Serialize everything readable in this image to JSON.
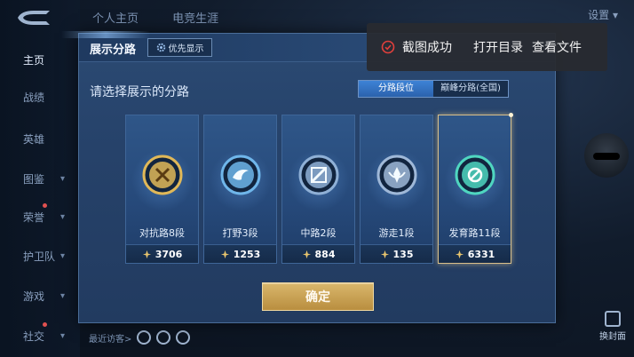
{
  "background": {
    "top_tabs": [
      "个人主页",
      "电竞生涯"
    ],
    "settings_label": "设置",
    "sidebar_items": [
      {
        "label": "主页",
        "active": true,
        "has_chevron": false,
        "badge": false
      },
      {
        "label": "战绩",
        "active": false,
        "has_chevron": false,
        "badge": false
      },
      {
        "label": "英雄",
        "active": false,
        "has_chevron": false,
        "badge": false
      },
      {
        "label": "图鉴",
        "active": false,
        "has_chevron": true,
        "badge": false
      },
      {
        "label": "荣誉",
        "active": false,
        "has_chevron": true,
        "badge": true
      },
      {
        "label": "护卫队",
        "active": false,
        "has_chevron": true,
        "badge": false
      },
      {
        "label": "游戏",
        "active": false,
        "has_chevron": true,
        "badge": false
      },
      {
        "label": "社交",
        "active": false,
        "has_chevron": true,
        "badge": true
      }
    ],
    "recent_visitors_label": "最近访客>",
    "replace_cover_label": "换封面"
  },
  "modal": {
    "title": "展示分路",
    "priority_label": "优先显示",
    "prompt": "请选择展示的分路",
    "toggle": {
      "active": "分路段位",
      "inactive": "巅峰分路(全国)"
    },
    "roles": [
      {
        "name": "对抗路8段",
        "score": "3706",
        "icon": "clash-lane-icon",
        "color": "#e0b858",
        "selected": false
      },
      {
        "name": "打野3段",
        "score": "1253",
        "icon": "jungle-icon",
        "color": "#6fb6ea",
        "selected": false
      },
      {
        "name": "中路2段",
        "score": "884",
        "icon": "mid-lane-icon",
        "color": "#8fb0d6",
        "selected": false
      },
      {
        "name": "游走1段",
        "score": "135",
        "icon": "roam-icon",
        "color": "#9fb8d8",
        "selected": false
      },
      {
        "name": "发育路11段",
        "score": "6331",
        "icon": "farm-lane-icon",
        "color": "#4fd6c0",
        "selected": true
      }
    ],
    "confirm_label": "确定"
  },
  "toast": {
    "message": "截图成功",
    "action_open": "打开目录",
    "action_view": "查看文件"
  },
  "colors": {
    "accent_gold": "#d9b76c",
    "toggle_blue": "#3e83d6",
    "toast_ok_red": "#e0403c"
  }
}
